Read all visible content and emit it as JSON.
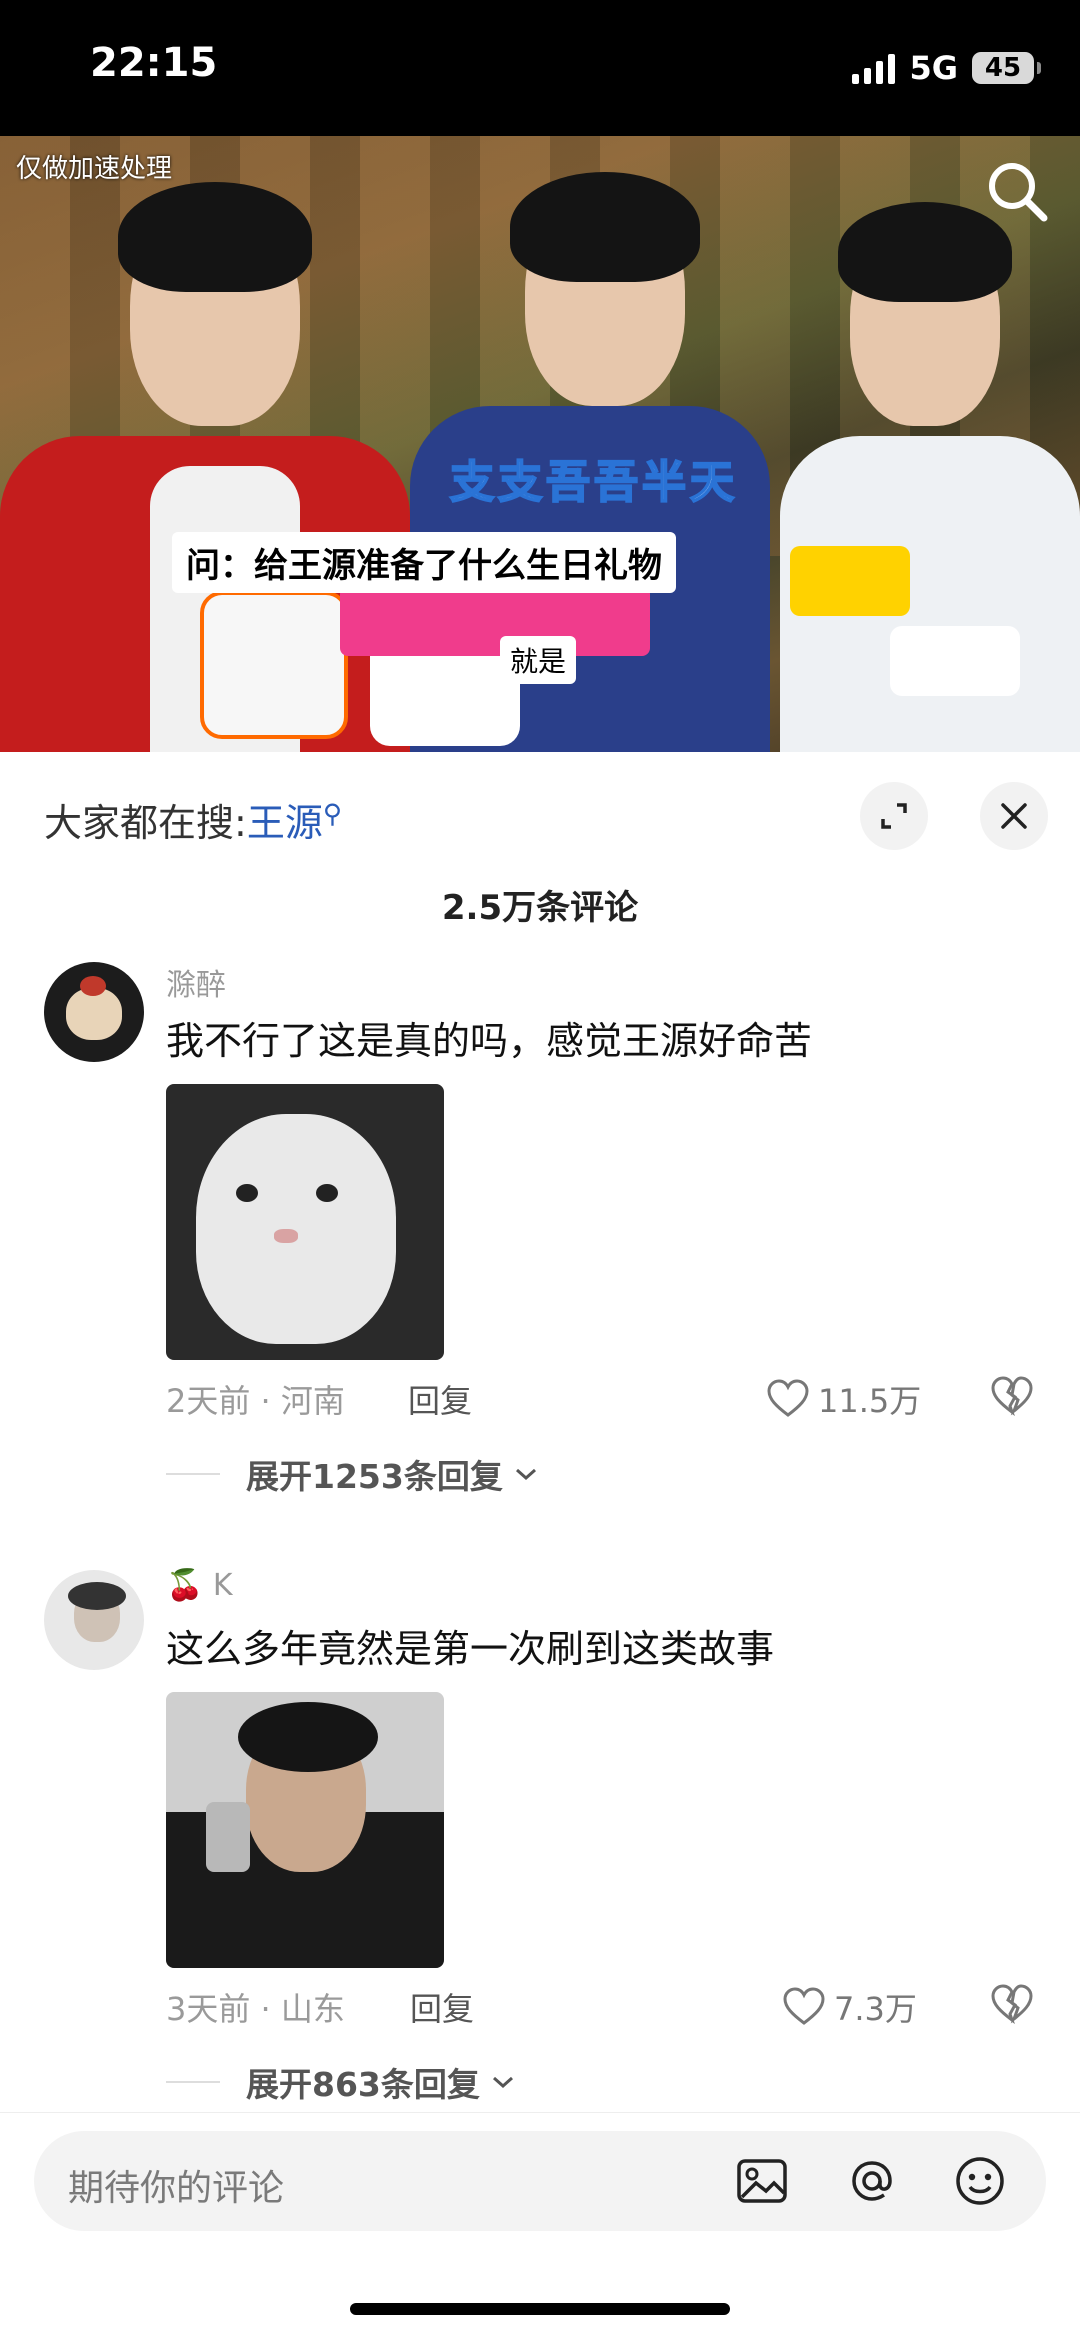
{
  "status_bar": {
    "time": "22:15",
    "network": "5G",
    "battery": "45"
  },
  "video": {
    "watermark": "仅做加速处理",
    "subtitle_top": "支支吾吾半天",
    "subtitle_question": "问：给王源准备了什么生日礼物",
    "subtitle_answer": "就是"
  },
  "sheet": {
    "trending_prefix": "大家都在搜:",
    "trending_keyword": "王源",
    "comment_count": "2.5万条评论"
  },
  "comments": [
    {
      "user": "滁醉",
      "text": "我不行了这是真的吗，感觉王源好命苦",
      "meta": "2天前 · 河南",
      "reply": "回复",
      "likes": "11.5万",
      "expand": "展开1253条回复"
    },
    {
      "user": "K",
      "user_emoji": "🍒",
      "text": "这么多年竟然是第一次刷到这类故事",
      "meta": "3天前 · 山东",
      "reply": "回复",
      "likes": "7.3万",
      "expand": "展开863条回复"
    }
  ],
  "input": {
    "placeholder": "期待你的评论"
  },
  "icons": {
    "search": "search-icon",
    "expand": "expand-icon",
    "close": "close-icon",
    "like": "heart-icon",
    "dislike": "broken-heart-icon",
    "image": "image-icon",
    "mention": "at-icon",
    "emoji": "emoji-icon"
  }
}
